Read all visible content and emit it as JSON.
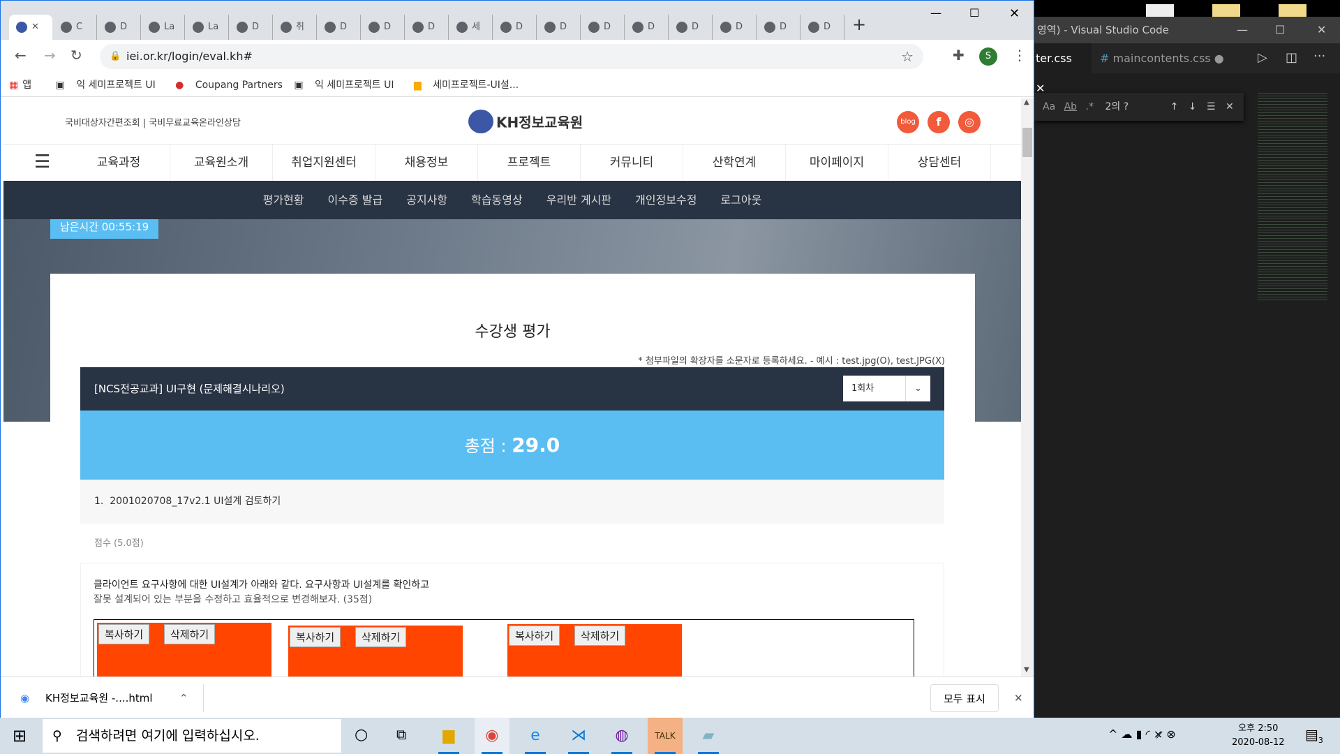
{
  "browser": {
    "tabs": [
      "C",
      "D",
      "La",
      "La",
      "D",
      "취",
      "D",
      "D",
      "D",
      "세",
      "D",
      "D",
      "D",
      "D",
      "D",
      "D",
      "D",
      "D"
    ],
    "url": "iei.or.kr/login/eval.kh#",
    "profile": "S",
    "bookmarks": [
      "앱",
      "익 세미프로젝트 UI",
      "Coupang Partners",
      "익 세미프로젝트 UI",
      "세미프로젝트-UI설..."
    ]
  },
  "site": {
    "top_links": "국비대상자간편조회 | 국비무료교육온라인상담",
    "logo": "KH정보교육원",
    "social": [
      "blog",
      "f",
      "◎"
    ],
    "nav": [
      "교육과정",
      "교육원소개",
      "취업지원센터",
      "채용정보",
      "프로젝트",
      "커뮤니티",
      "산학연계",
      "마이페이지",
      "상담센터"
    ],
    "subnav": [
      "평가현황",
      "이수증 발급",
      "공지사항",
      "학습동영상",
      "우리반 게시판",
      "개인정보수정",
      "로그아웃"
    ],
    "timer": "남은시간 00:55:19"
  },
  "eval": {
    "title": "수강생 평가",
    "note": "* 첨부파일의 확장자를 소문자로 등록하세요. - 예시 : test.jpg(O), test.JPG(X)",
    "course": "[NCS전공교과] UI구현 (문제해결시나리오)",
    "round": "1회차",
    "score_label": "총점 : ",
    "score": "29.0",
    "q_num": "1.",
    "q_title": "2001020708_17v2.1 UI설계 검토하기",
    "points": "점수 (5.0점)",
    "q_line1": "클라이언트 요구사항에 대한 UI설계가 아래와 같다. 요구사항과 UI설계를 확인하고",
    "q_line2": "잘못 설계되어 있는 부분을 수정하고 효율적으로 변경해보자. (35점)",
    "copy": "복사하기",
    "delete": "삭제하기"
  },
  "download": {
    "file": "KH정보교육원 -....html",
    "show_all": "모두 표시"
  },
  "vscode": {
    "title": "영역) - Visual Studio Code",
    "tabs": [
      "ter.css",
      "maincontents.css"
    ],
    "find": "2의 ?"
  },
  "taskbar": {
    "search": "검색하려면 여기에 입력하십시오.",
    "time": "오후 2:50",
    "date": "2020-08-12",
    "notif": "3"
  }
}
